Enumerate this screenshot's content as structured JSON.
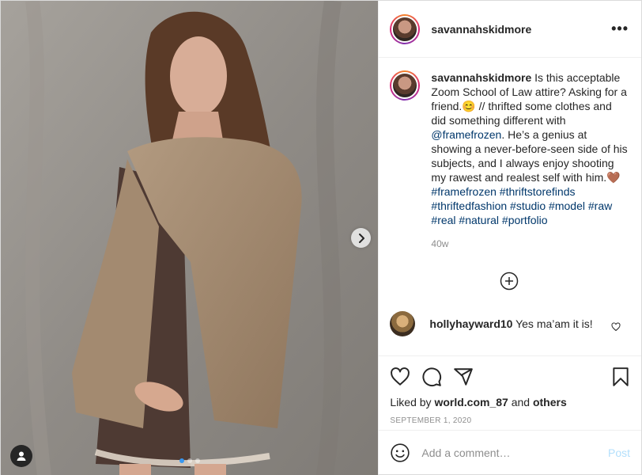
{
  "post": {
    "username": "savannahskidmore",
    "more_icon": "more-horizontal-icon",
    "caption": {
      "username": "savannahskidmore",
      "text_1": " Is this acceptable Zoom School of Law attire? Asking for a friend.",
      "emoji_1": "😊",
      "text_2": " // thrifted some clothes and did something different with ",
      "mention": "@framefrozen",
      "text_3": ". He’s a genius at showing a never-before-seen side of his subjects, and I always enjoy shooting my rawest and realest self with him.",
      "emoji_2": "🤎",
      "hashtags": "#framefrozen #thriftstorefinds #thriftedfashion #studio #model #raw #real #natural #portfolio"
    },
    "time_ago": "40w",
    "reply": {
      "username": "hollyhayward10",
      "text": "Yes ma’am it is!"
    },
    "likes": {
      "prefix": "Liked by ",
      "user": "world.com_87",
      "middle": " and ",
      "others": "others"
    },
    "date": "September 1, 2020",
    "comment_placeholder": "Add a comment…",
    "post_label": "Post"
  },
  "carousel": {
    "slides": 3,
    "active": 1
  },
  "colors": {
    "link": "#00376b",
    "accent": "#3897f0",
    "post_disabled": "#b2dffc"
  },
  "icons": [
    "heart-icon",
    "comment-icon",
    "share-icon",
    "bookmark-icon",
    "add-circle-icon",
    "emoji-icon",
    "chevron-right-icon",
    "user-tag-icon"
  ]
}
